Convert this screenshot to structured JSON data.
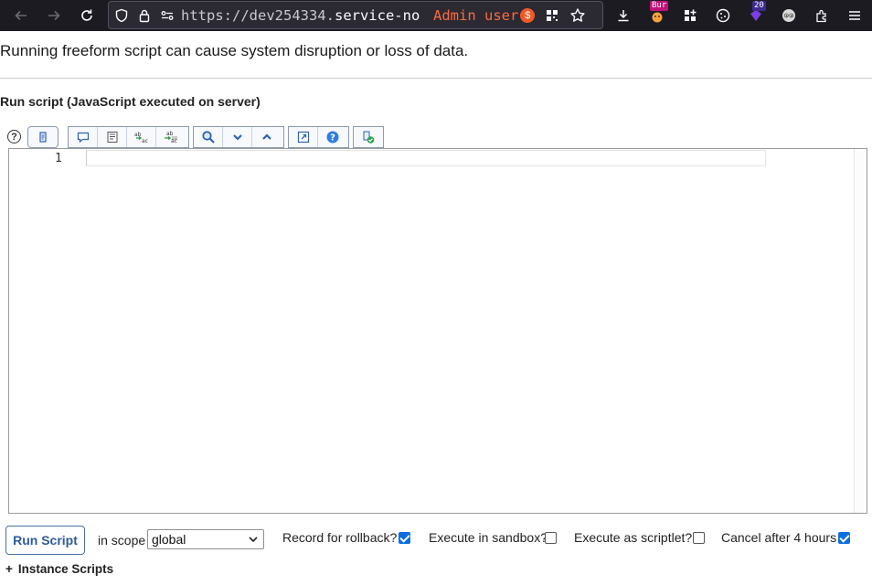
{
  "browser": {
    "url_prefix": "https://dev254334.",
    "url_domain": "service-no",
    "admin_label": "Admin user",
    "admin_badge": "$",
    "ext_badge_1": "Bur",
    "ext_badge_2": "20"
  },
  "page": {
    "warning": "Running freeform script can cause system disruption or loss of data.",
    "section_title": "Run script (JavaScript executed on server)",
    "help_glyph": "?",
    "editor": {
      "line_number": "1"
    }
  },
  "controls": {
    "run_label": "Run Script",
    "scope_label": "in scope",
    "scope_value": "global",
    "rollback_label": "Record for rollback?",
    "rollback_checked": true,
    "sandbox_label": "Execute in sandbox?",
    "sandbox_checked": false,
    "scriptlet_label": "Execute as scriptlet?",
    "scriptlet_checked": false,
    "cancel_label": "Cancel after 4 hours",
    "cancel_checked": true
  },
  "instance_scripts": {
    "plus": "+",
    "label": "Instance Scripts"
  },
  "colors": {
    "browser_bg": "#1c1b22",
    "admin_accent": "#ff6a3d",
    "button_text": "#2e5a9a",
    "checkbox": "#0b6ede"
  }
}
